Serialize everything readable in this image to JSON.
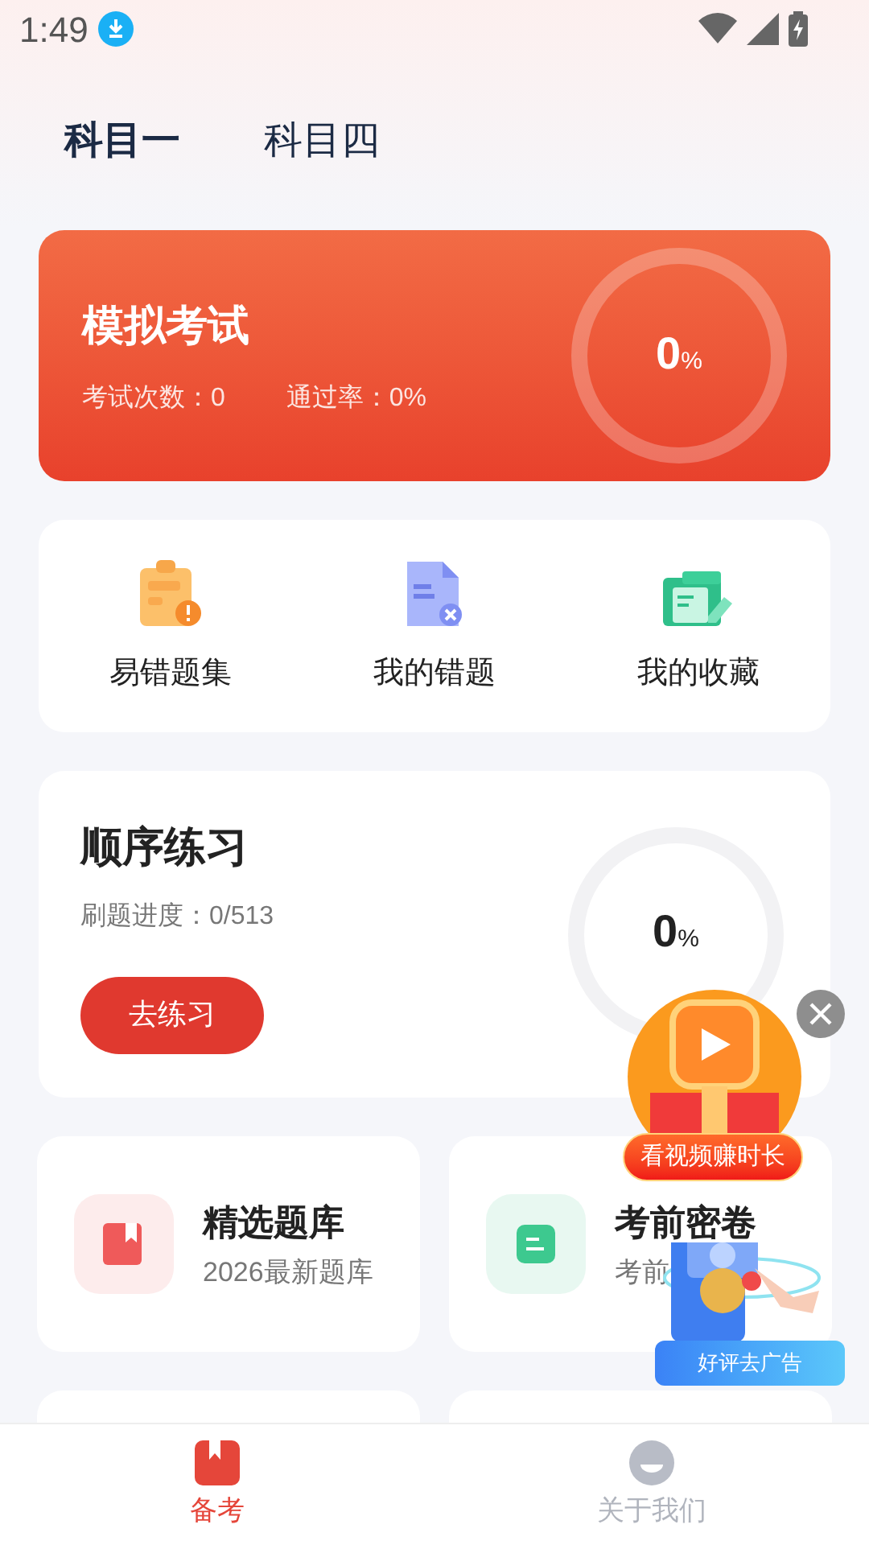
{
  "status_bar": {
    "time": "1:49"
  },
  "tabs": [
    {
      "label": "科目一",
      "selected": true
    },
    {
      "label": "科目四",
      "selected": false
    }
  ],
  "exam_card": {
    "title": "模拟考试",
    "stats": [
      "考试次数：0",
      "通过率：0%"
    ],
    "ring": {
      "value": "0",
      "unit": "%"
    }
  },
  "shortcuts": [
    {
      "label": "易错题集",
      "kind": "error-prone"
    },
    {
      "label": "我的错题",
      "kind": "wrong"
    },
    {
      "label": "我的收藏",
      "kind": "favorite"
    }
  ],
  "practice": {
    "title": "顺序练习",
    "progress": "刷题进度：0/513",
    "button": "去练习",
    "ring": {
      "value": "0",
      "unit": "%"
    }
  },
  "banks": [
    {
      "title": "精选题库",
      "subtitle": "2026最新题库",
      "kind": "selected"
    },
    {
      "title": "考前密卷",
      "subtitle": "考前",
      "kind": "secret"
    }
  ],
  "ad": {
    "badge": "看视频赚时长",
    "button": "好评去广告"
  },
  "bottom_nav": [
    {
      "label": "备考",
      "selected": true,
      "kind": "book"
    },
    {
      "label": "关于我们",
      "selected": false,
      "kind": "about"
    }
  ]
}
